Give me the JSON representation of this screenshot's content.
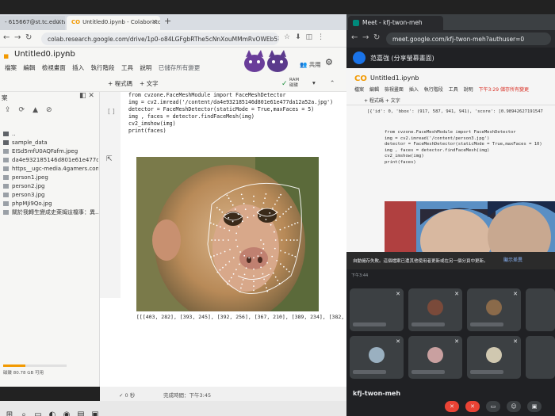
{
  "colab": {
    "tabs": [
      {
        "label": "- 615667@st.tc.edu.tw"
      },
      {
        "label": "Untitled0.ipynb - Colaborator"
      }
    ],
    "url": "colab.research.google.com/drive/1p0-o84LGFgbRThe5cNnXouMMmRvOWEb5?hl...",
    "notebook_title": "Untitled0.ipynb",
    "menus": [
      "檔案",
      "編輯",
      "檢視畫面",
      "插入",
      "執行階段",
      "工具",
      "說明",
      "已儲存所有變更"
    ],
    "share_label": "共用",
    "toolbar": {
      "code_label": "+ 程式碼",
      "text_label": "+ 文字",
      "ram_label": "RAM",
      "disk_label": "磁碟"
    },
    "sidebar": {
      "title": "案",
      "files": [
        {
          "name": "..",
          "type": "folder"
        },
        {
          "name": "sample_data",
          "type": "folder"
        },
        {
          "name": "EISd5mfU0AQFafm.jpeg",
          "type": "file"
        },
        {
          "name": "da4e932185146d801e61e477da12...",
          "type": "file"
        },
        {
          "name": "https__ugc-media.4gamers.com.tw...",
          "type": "file"
        },
        {
          "name": "person1.jpeg",
          "type": "file"
        },
        {
          "name": "person2.jpg",
          "type": "file"
        },
        {
          "name": "person3.jpg",
          "type": "file"
        },
        {
          "name": "phpMJi9Qo.jpg",
          "type": "file"
        },
        {
          "name": "關於我轉生變成史萊姆這檔事：異...",
          "type": "file"
        }
      ],
      "disk_text": "磁碟 80.78 GB 可用",
      "disk_fraction": 0.35
    },
    "cell": {
      "code_lines": [
        "from cvzone.FaceMeshModule import FaceMeshDetector",
        "img = cv2.imread('/content/da4e932185146d801e61e477da12a52a.jpg')",
        "detector = FaceMeshDetector(staticMode = True,maxFaces = 5)",
        "img , faces = detector.findFaceMesh(img)",
        "",
        "cv2_imshow(img)",
        "print(faces)"
      ],
      "output_text": "[[[403, 282], [393, 245], [392, 256], [367, 210], [389, 234], [382, 218"
    },
    "status": {
      "left": "✓ 0 秒",
      "right": "完成時間：下午3:45"
    }
  },
  "meet": {
    "tab_label": "Meet - kfj-twon-meh",
    "url": "meet.google.com/kfj-twon-meh?authuser=0",
    "presenter": "范嘉強 (分享螢幕畫面)",
    "shared": {
      "title": "Untitled1.ipynb",
      "menus": [
        "檔案",
        "編輯",
        "檢視畫面",
        "插入",
        "執行階段",
        "工具",
        "說明"
      ],
      "warn": "下午3:29 儲存所有變更",
      "tools": "+ 程式碼  + 文字",
      "output_line": "[{'id': 0, 'bbox': (917, 587, 941, 941), 'score': [0.98942627191547",
      "code_lines": [
        "from cvzone.FaceMeshModule import FaceMeshDetector",
        "img = cv2.imread('/content/person3.jpg')",
        "detector = FaceMeshDetector(staticMode = True,maxFaces = 10)",
        "img , faces = detector.findFaceMesh(img)",
        "",
        "cv2_imshow(img)",
        "print(faces)"
      ],
      "toast": "自動儲存失敗。這個檔案已遭其他使用者更新或在另一個分頁中更新。",
      "toast_button": "顯示差異",
      "time": "下午3:44"
    },
    "meeting_code": "kfj-twon-meh"
  }
}
